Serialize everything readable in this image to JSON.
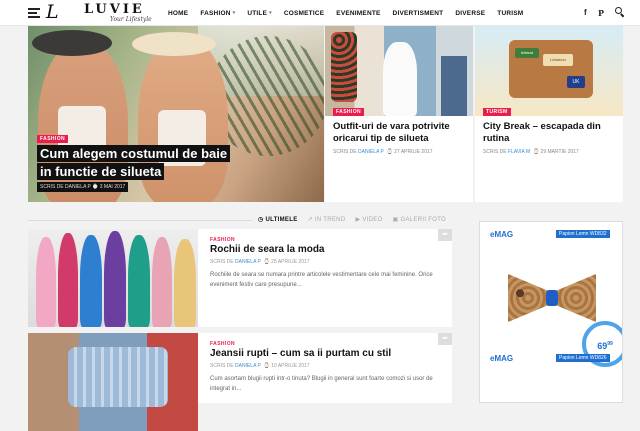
{
  "logo": {
    "mark": "L",
    "name": "LUVIE",
    "tagline": "Your Lifestyle"
  },
  "nav": [
    {
      "label": "HOME",
      "has_dropdown": false
    },
    {
      "label": "FASHION",
      "has_dropdown": true
    },
    {
      "label": "UTILE",
      "has_dropdown": true
    },
    {
      "label": "COSMETICE",
      "has_dropdown": false
    },
    {
      "label": "EVENIMENTE",
      "has_dropdown": false
    },
    {
      "label": "DIVERTISMENT",
      "has_dropdown": false
    },
    {
      "label": "DIVERSE",
      "has_dropdown": false
    },
    {
      "label": "TURISM",
      "has_dropdown": false
    }
  ],
  "header_icons": {
    "facebook": "f",
    "pinterest": "P",
    "search": "search-icon"
  },
  "hero": {
    "category": "FASHION",
    "title_line1": "Cum alegem costumul de baie",
    "title_line2": "in functie de silueta",
    "meta": "SCRIS DE DANIELA P  ⌚ 3 MAI 2017"
  },
  "cards": [
    {
      "category": "FASHION",
      "title": "Outfit-uri de vara potrivite oricarui tip de silueta",
      "meta_prefix": "SCRIS DE",
      "author": "DANIELA P",
      "date": "⌚ 27 APRILIE 2017"
    },
    {
      "category": "TURISM",
      "title": "City Break – escapada din rutina",
      "meta_prefix": "SCRIS DE",
      "author": "FLAVIA M",
      "date": "⌚ 29 MARTIE 2017"
    }
  ],
  "tabs": [
    {
      "icon": "◷",
      "label": "ULTIMELE",
      "active": true
    },
    {
      "icon": "↗",
      "label": "IN TREND",
      "active": false
    },
    {
      "icon": "▶",
      "label": "VIDEO",
      "active": false
    },
    {
      "icon": "▣",
      "label": "GALERII FOTO",
      "active": false
    }
  ],
  "posts": [
    {
      "category": "FASHION",
      "title": "Rochii de seara la moda",
      "meta_prefix": "SCRIS DE",
      "author": "DANIELA P",
      "date": "⌚ 25 APRILIE 2017",
      "excerpt": "Rochiile de seara se numara printre articolele vestimentare cele mai feminine. Orice eveniment festiv care presupune..."
    },
    {
      "category": "FASHION",
      "title": "Jeansii rupti – cum sa ii purtam cu stil",
      "meta_prefix": "SCRIS DE",
      "author": "DANIELA P",
      "date": "⌚ 10 APRILIE 2017",
      "excerpt": "Cum asortam blugii rupti intr-o tinuta? Blugii in general sunt foarte comozi si usor de integrat in..."
    }
  ],
  "ad": {
    "brand_a": "e",
    "brand_b": "MAG",
    "product_1": "Papion Lemn WD832",
    "product_2": "Papion Lemn WD826",
    "price_main": "69",
    "price_cents": "99",
    "card_sticker_1": "Ireland",
    "card_sticker_2": "UK",
    "card_sticker_3": "Lebanon"
  },
  "colors": {
    "accent": "#e91e4d",
    "link": "#3b8fd6",
    "emag_blue": "#1f6fd1"
  }
}
